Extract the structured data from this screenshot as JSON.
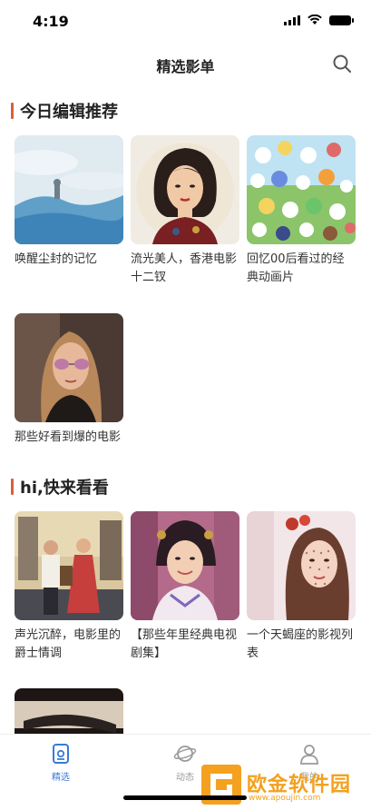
{
  "status_bar": {
    "time": "4:19"
  },
  "nav": {
    "title": "精选影单"
  },
  "sections": [
    {
      "title": "今日编辑推荐",
      "items": [
        {
          "title": "唤醒尘封的记忆"
        },
        {
          "title": "流光美人，香港电影十二钗"
        },
        {
          "title": "回忆00后看过的经典动画片"
        },
        {
          "title": "那些好看到爆的电影"
        }
      ]
    },
    {
      "title": "hi,快来看看",
      "items": [
        {
          "title": "声光沉醉，电影里的爵士情调"
        },
        {
          "title": "【那些年里经典电视剧集】"
        },
        {
          "title": "一个天蝎座的影视列表"
        },
        {
          "title": ""
        }
      ]
    }
  ],
  "tab_bar": {
    "tabs": [
      {
        "label": "精选",
        "icon": "film-icon",
        "active": true
      },
      {
        "label": "动态",
        "icon": "planet-icon",
        "active": false
      },
      {
        "label": "我的",
        "icon": "person-icon",
        "active": false
      }
    ]
  },
  "watermark": {
    "text": "欧金软件园",
    "url": "www.apoujin.com"
  },
  "colors": {
    "accent": "#d4623a",
    "tab_active": "#3a7bd5",
    "tab_inactive": "#9a9a9a",
    "watermark": "#f3a11e"
  }
}
